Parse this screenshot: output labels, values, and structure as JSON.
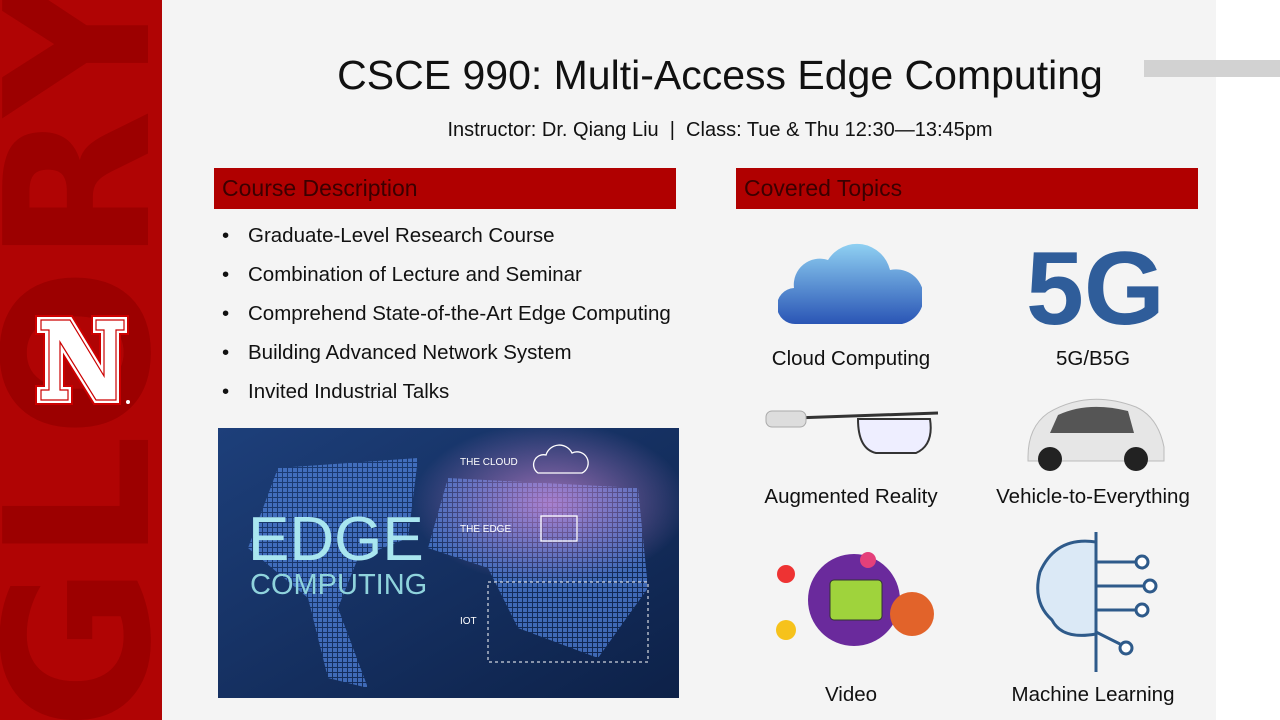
{
  "sidebar": {
    "background_word": "GLORY",
    "logo_letter": "N",
    "brand_color": "#b00404"
  },
  "header": {
    "title": "CSCE 990: Multi-Access Edge Computing",
    "subtitle": "Instructor: Dr. Qiang Liu  |  Class: Tue & Thu 12:30—13:45pm"
  },
  "description": {
    "heading": "Course Description",
    "items": [
      "Graduate-Level Research Course",
      "Combination of Lecture and Seminar",
      "Comprehend State-of-the-Art Edge Computing",
      "Building Advanced Network System",
      "Invited Industrial Talks"
    ]
  },
  "edge_image": {
    "big1": "EDGE",
    "big2": "COMPUTING",
    "cloud": "THE CLOUD",
    "edge": "THE EDGE",
    "iot": "IOT"
  },
  "topics": {
    "heading": "Covered Topics",
    "items": [
      {
        "label": "Cloud Computing",
        "icon": "cloud-icon"
      },
      {
        "label": "5G/B5G",
        "icon": "5g-icon"
      },
      {
        "label": "Augmented Reality",
        "icon": "ar-glasses-icon"
      },
      {
        "label": "Vehicle-to-Everything",
        "icon": "car-icon"
      },
      {
        "label": "Video",
        "icon": "video-icon"
      },
      {
        "label": "Machine Learning",
        "icon": "brain-circuit-icon"
      }
    ]
  }
}
